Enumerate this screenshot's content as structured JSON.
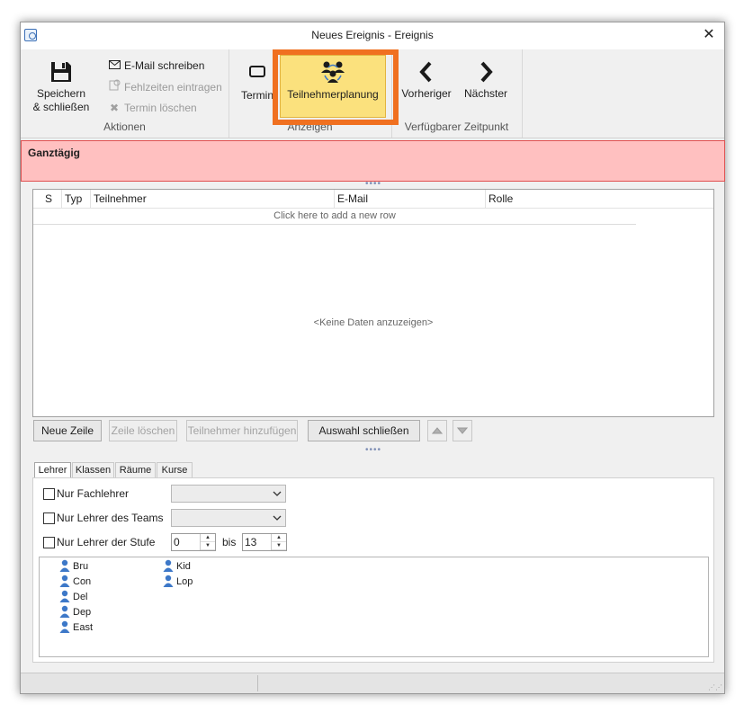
{
  "window": {
    "title": "Neues Ereignis - Ereignis"
  },
  "ribbon": {
    "actions": {
      "save_label_line1": "Speichern",
      "save_label_line2": "& schließen",
      "email": "E-Mail schreiben",
      "absence": "Fehlzeiten eintragen",
      "delete": "Termin löschen",
      "group_label": "Aktionen"
    },
    "view": {
      "appointment": "Termin",
      "participant_planning": "Teilnehmerplanung",
      "group_label": "Anzeigen"
    },
    "slot": {
      "previous": "Vorheriger",
      "next": "Nächster",
      "group_label": "Verfügbarer Zeitpunkt"
    }
  },
  "allday": {
    "label": "Ganztägig"
  },
  "grid": {
    "columns": [
      "S",
      "Typ",
      "Teilnehmer",
      "E-Mail",
      "Rolle"
    ],
    "new_row_hint": "Click here to add a new row",
    "empty_text": "<Keine Daten anzuzeigen>"
  },
  "buttons": {
    "new_row": "Neue Zeile",
    "delete_row": "Zeile löschen",
    "add_participant": "Teilnehmer hinzufügen",
    "close_selection": "Auswahl schließen"
  },
  "tabs": [
    "Lehrer",
    "Klassen",
    "Räume",
    "Kurse"
  ],
  "filters": {
    "subject_teacher": "Nur Fachlehrer",
    "team_teacher": "Nur Lehrer des Teams",
    "level_teacher": "Nur Lehrer der Stufe",
    "from_value": "0",
    "bis_label": "bis",
    "to_value": "13"
  },
  "people_col1": [
    "Bru",
    "Con",
    "Del",
    "Dep",
    "East"
  ],
  "people_col2": [
    "Kid",
    "Lop"
  ],
  "colors": {
    "accent_highlight": "#f07020",
    "active_button": "#fbe17d",
    "allday_bg": "#ffc0c0",
    "person_icon": "#3d78c8"
  }
}
